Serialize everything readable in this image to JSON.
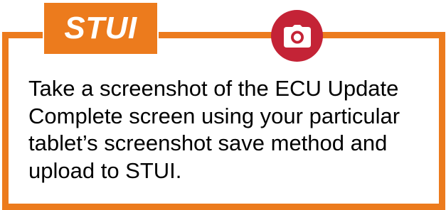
{
  "tag": {
    "label": "STUI"
  },
  "icon": {
    "name": "camera-icon",
    "color": "#c42336"
  },
  "instruction": {
    "lines": [
      "Take a screenshot of the ECU Update",
      "Complete screen using your particular",
      "tablet’s screenshot save method and",
      "upload to STUI."
    ]
  },
  "colors": {
    "accent": "#ec7b1d",
    "icon_background": "#c42336",
    "text": "#000000"
  }
}
